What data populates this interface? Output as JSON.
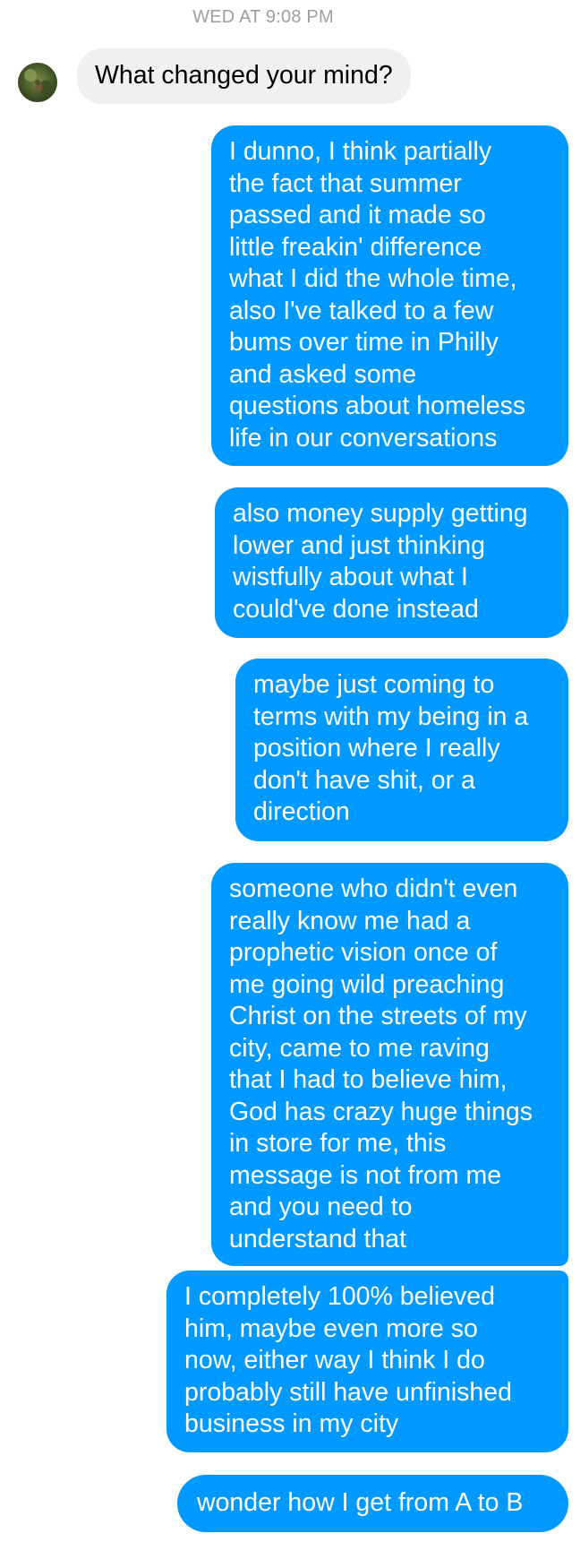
{
  "conversation": {
    "timestamp": "WED AT 9:08 PM",
    "incoming": [
      {
        "text": "What changed your mind?"
      }
    ],
    "outgoing": [
      {
        "text": "I dunno, I think partially\nthe fact that summer\npassed and it made so\nlittle freakin' difference\nwhat I did the whole time,\nalso I've talked to a few\nbums over time in Philly\nand asked some\nquestions about homeless\nlife in our conversations"
      },
      {
        "text": "also money supply getting\nlower and just thinking\nwistfully about what I\ncould've done instead"
      },
      {
        "text": "maybe just coming to\nterms with my being in a\nposition where I really\ndon't have shit, or a\ndirection"
      },
      {
        "text": "someone who didn't even\nreally know me had a\nprophetic vision once of\nme going wild preaching\nChrist on the streets of my\ncity, came to me raving\nthat I had to believe him,\nGod has crazy huge things\nin store for me, this\nmessage is not from me\nand you need to\nunderstand that"
      },
      {
        "text": "I completely 100% believed\nhim, maybe even more so\nnow, either way I think I do\nprobably still have unfinished\nbusiness in my city"
      },
      {
        "text": "wonder how I get from A to B"
      }
    ]
  },
  "colors": {
    "outgoing_bubble": "#0099ff",
    "incoming_bubble": "#f0f0f0",
    "timestamp_text": "#9e9e9e"
  },
  "icons": {
    "contact_avatar": "avatar-photo"
  }
}
